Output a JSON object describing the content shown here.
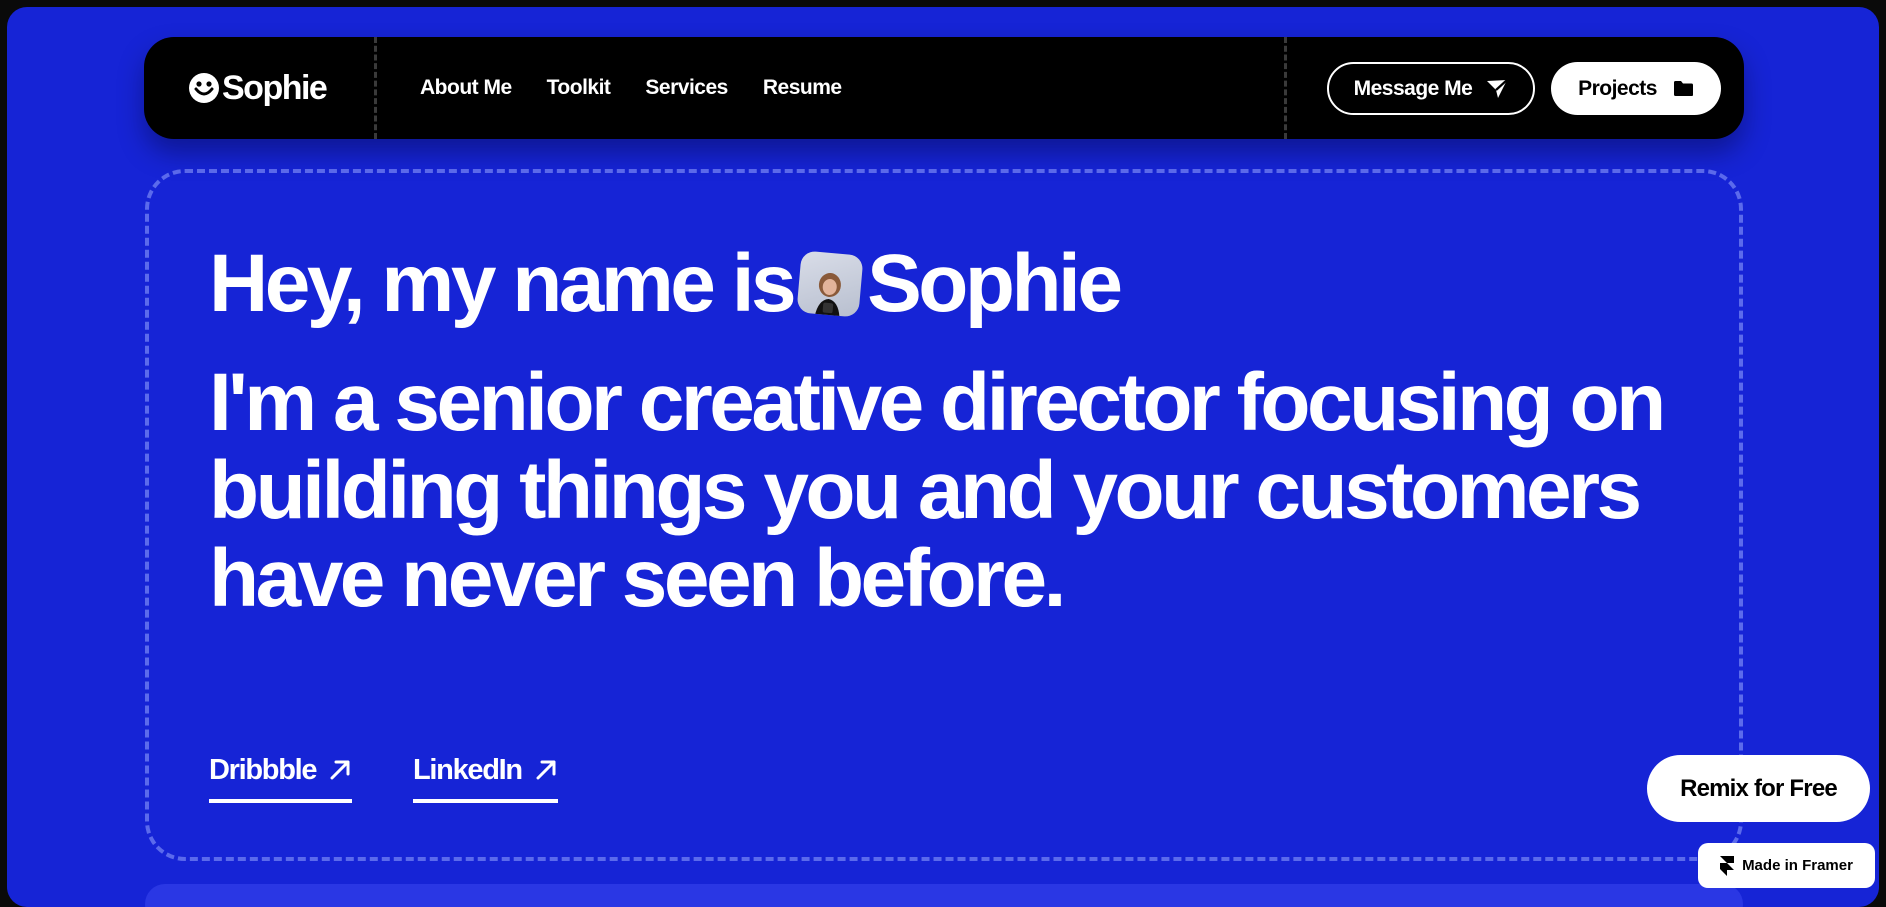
{
  "colors": {
    "background": "#1624d6",
    "nav": "#000000",
    "text": "#ffffff"
  },
  "nav": {
    "logo_text": "Sophie",
    "links": [
      "About Me",
      "Toolkit",
      "Services",
      "Resume"
    ],
    "message_label": "Message Me",
    "projects_label": "Projects"
  },
  "hero": {
    "greeting_prefix": "Hey, my name is",
    "greeting_name": "Sophie",
    "headline": "I'm a senior creative director focusing on building things you and your customers have never seen before.",
    "links": [
      "Dribbble",
      "LinkedIn"
    ]
  },
  "badges": {
    "remix_label": "Remix for Free",
    "framer_label": "Made in Framer"
  },
  "icons": {
    "logo": "smiley-face-icon",
    "message": "send-plane-icon",
    "projects": "folder-icon",
    "external": "arrow-up-right-icon",
    "framer": "framer-logo-icon"
  }
}
